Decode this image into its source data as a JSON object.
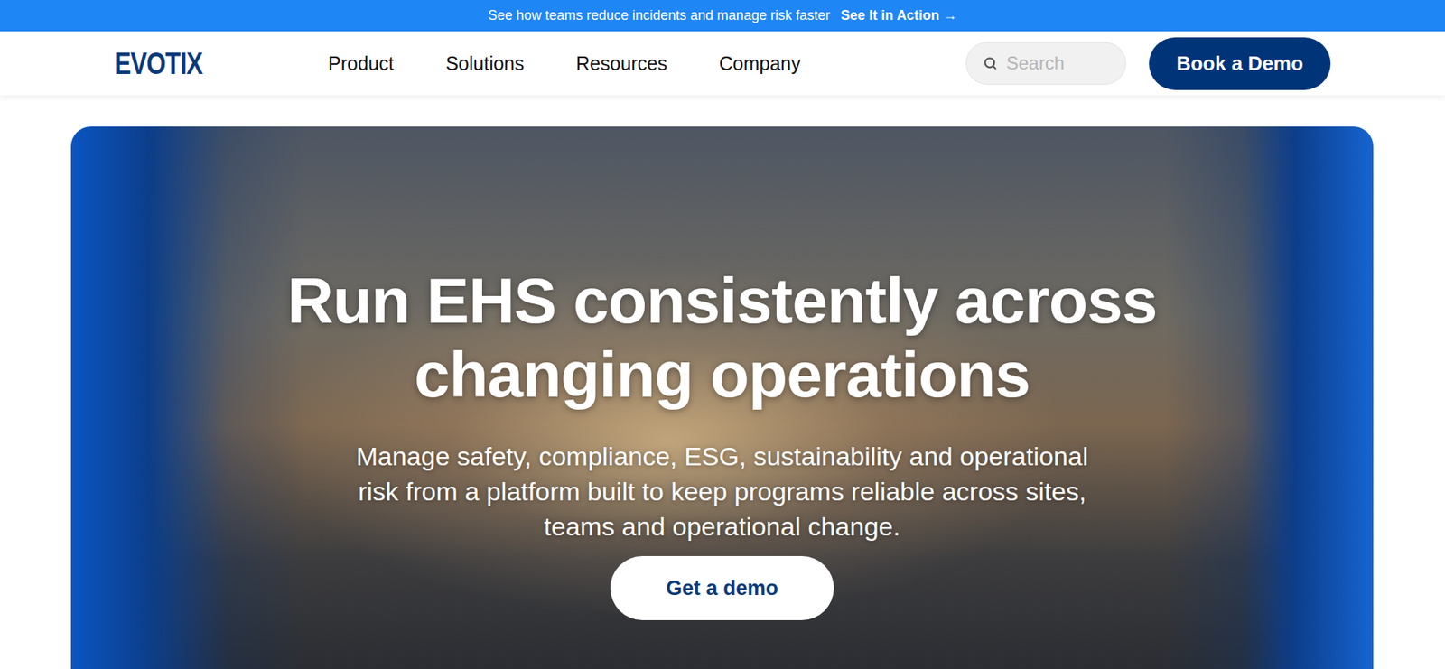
{
  "banner": {
    "text": "See how teams reduce incidents and manage risk faster",
    "link": "See It in Action →"
  },
  "header": {
    "logo": "EVOTIX",
    "nav": [
      {
        "label": "Product"
      },
      {
        "label": "Solutions"
      },
      {
        "label": "Resources"
      },
      {
        "label": "Company"
      }
    ],
    "search": {
      "placeholder": "Search"
    },
    "cta": "Book a Demo"
  },
  "hero": {
    "title": "Run EHS consistently across changing operations",
    "subtitle": "Manage safety, compliance, ESG, sustainability and operational risk from a platform built to keep programs reliable across sites, teams and operational change.",
    "cta": "Get a demo"
  }
}
